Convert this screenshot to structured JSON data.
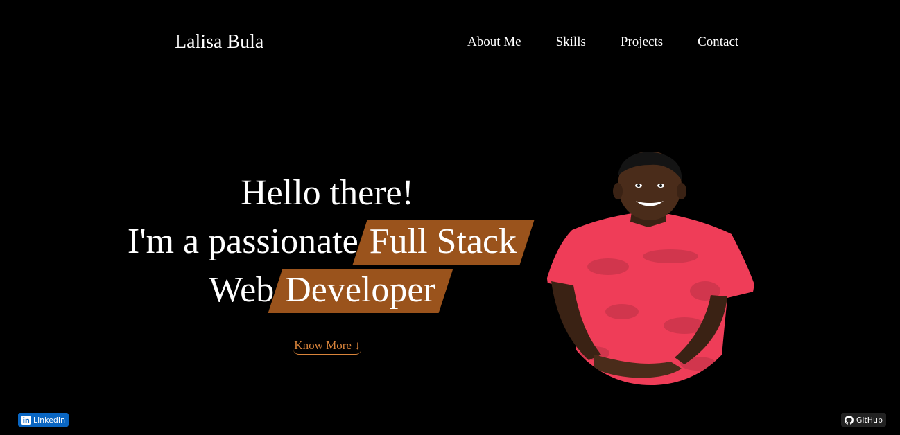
{
  "header": {
    "brand": "Lalisa Bula",
    "nav": [
      "About Me",
      "Skills",
      "Projects",
      "Contact"
    ]
  },
  "hero": {
    "greeting": "Hello there!",
    "line2_prefix": "I'm a passionate",
    "line2_highlight": "Full Stack",
    "line3_prefix": "Web",
    "line3_highlight": "Developer",
    "cta": "Know More ↓"
  },
  "social": {
    "linkedin": "LinkedIn",
    "github": "GitHub"
  },
  "colors": {
    "background": "#000000",
    "text": "#ffffff",
    "highlight": "#9a531c",
    "cta": "#d9843b",
    "shirt": "#ef3d58",
    "linkedin": "#0a66c2"
  },
  "icons": {
    "linkedin": "linkedin-icon",
    "github": "github-icon"
  }
}
